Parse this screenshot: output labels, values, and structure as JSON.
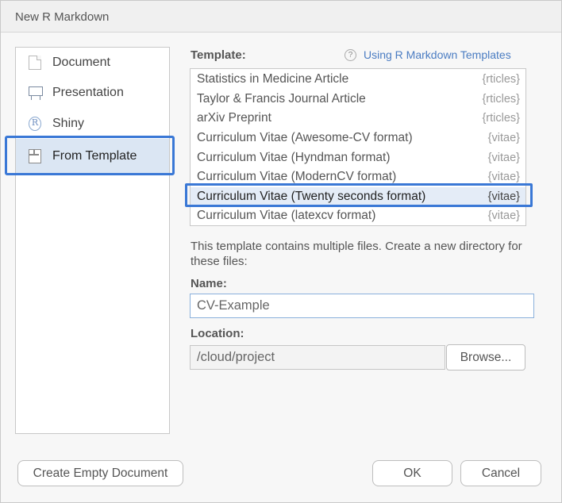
{
  "window": {
    "title": "New R Markdown"
  },
  "sidebar": {
    "items": [
      {
        "label": "Document",
        "icon": "document-icon"
      },
      {
        "label": "Presentation",
        "icon": "presentation-icon"
      },
      {
        "label": "Shiny",
        "icon": "shiny-icon",
        "icon_glyph": "R"
      },
      {
        "label": "From Template",
        "icon": "template-icon",
        "selected": true
      }
    ]
  },
  "template_section": {
    "label": "Template:",
    "help_icon_glyph": "?",
    "help_link": "Using R Markdown Templates",
    "templates": [
      {
        "name": "Statistics in Medicine Article",
        "package": "{rticles}"
      },
      {
        "name": "Taylor & Francis Journal Article",
        "package": "{rticles}"
      },
      {
        "name": "arXiv Preprint",
        "package": "{rticles}"
      },
      {
        "name": "Curriculum Vitae (Awesome-CV format)",
        "package": "{vitae}"
      },
      {
        "name": "Curriculum Vitae (Hyndman format)",
        "package": "{vitae}"
      },
      {
        "name": "Curriculum Vitae (ModernCV format)",
        "package": "{vitae}"
      },
      {
        "name": "Curriculum Vitae (Twenty seconds format)",
        "package": "{vitae}",
        "selected": true
      },
      {
        "name": "Curriculum Vitae (latexcv format)",
        "package": "{vitae}"
      }
    ]
  },
  "description": "This template contains multiple files. Create a new directory for these files:",
  "name_field": {
    "label": "Name:",
    "value": "CV-Example"
  },
  "location_field": {
    "label": "Location:",
    "value": "/cloud/project",
    "browse_label": "Browse..."
  },
  "footer": {
    "create_empty_label": "Create Empty Document",
    "ok_label": "OK",
    "cancel_label": "Cancel"
  },
  "colors": {
    "accent": "#3a78d6",
    "link": "#4a7cc2",
    "selection": "#dbe6f3"
  }
}
